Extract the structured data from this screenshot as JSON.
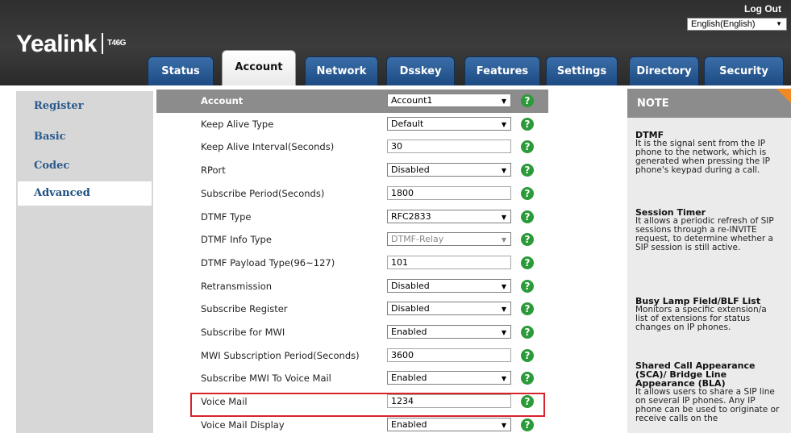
{
  "header": {
    "logo_text": "Yealink",
    "model": "T46G",
    "logout": "Log Out",
    "language": "English(English)"
  },
  "tabs": [
    {
      "label": "Status"
    },
    {
      "label": "Account",
      "active": true
    },
    {
      "label": "Network"
    },
    {
      "label": "Dsskey"
    },
    {
      "label": "Features"
    },
    {
      "label": "Settings"
    },
    {
      "label": "Directory"
    },
    {
      "label": "Security"
    }
  ],
  "leftnav": [
    {
      "label": "Register"
    },
    {
      "label": "Basic"
    },
    {
      "label": "Codec"
    },
    {
      "label": "Advanced",
      "active": true
    }
  ],
  "rows": [
    {
      "label": "Account",
      "value": "Account1",
      "type": "select"
    },
    {
      "label": "Keep Alive Type",
      "value": "Default",
      "type": "select"
    },
    {
      "label": "Keep Alive Interval(Seconds)",
      "value": "30",
      "type": "input"
    },
    {
      "label": "RPort",
      "value": "Disabled",
      "type": "select"
    },
    {
      "label": "Subscribe Period(Seconds)",
      "value": "1800",
      "type": "input"
    },
    {
      "label": "DTMF Type",
      "value": "RFC2833",
      "type": "select"
    },
    {
      "label": "DTMF Info Type",
      "value": "DTMF-Relay",
      "type": "select",
      "disabled": true
    },
    {
      "label": "DTMF Payload Type(96~127)",
      "value": "101",
      "type": "input"
    },
    {
      "label": "Retransmission",
      "value": "Disabled",
      "type": "select"
    },
    {
      "label": "Subscribe Register",
      "value": "Disabled",
      "type": "select"
    },
    {
      "label": "Subscribe for MWI",
      "value": "Enabled",
      "type": "select"
    },
    {
      "label": "MWI Subscription Period(Seconds)",
      "value": "3600",
      "type": "input"
    },
    {
      "label": "Subscribe MWI To Voice Mail",
      "value": "Enabled",
      "type": "select"
    },
    {
      "label": "Voice Mail",
      "value": "1234",
      "type": "input",
      "highlighted": true
    },
    {
      "label": "Voice Mail Display",
      "value": "Enabled",
      "type": "select"
    }
  ],
  "help_glyph": "?",
  "dropdown_glyph": "▼",
  "note": {
    "title": "NOTE",
    "sections": [
      {
        "title": "DTMF",
        "text": "It is the signal sent from the IP phone to the network, which is generated when pressing the IP phone's keypad during a call."
      },
      {
        "title": "Session Timer",
        "text": "It allows a periodic refresh of SIP sessions through a re-INVITE request, to determine whether a SIP session is still active."
      },
      {
        "title": "Busy Lamp Field/BLF List",
        "text": "Monitors a specific extension/a list of extensions for status changes on IP phones."
      },
      {
        "title": "Shared Call Appearance (SCA)/ Bridge Line Appearance (BLA)",
        "text": "It allows users to share a SIP line on several IP phones. Any IP phone can be used to originate or receive calls on the"
      }
    ]
  },
  "colors": {
    "header_bg": "#333333",
    "tab_blue": "#1d4b82",
    "nav_text": "#2b5a8c",
    "row_header_bg": "#8c8c8c",
    "help_green": "#2b9a38",
    "highlight_red": "#d8232a",
    "note_accent": "#f08a24"
  }
}
